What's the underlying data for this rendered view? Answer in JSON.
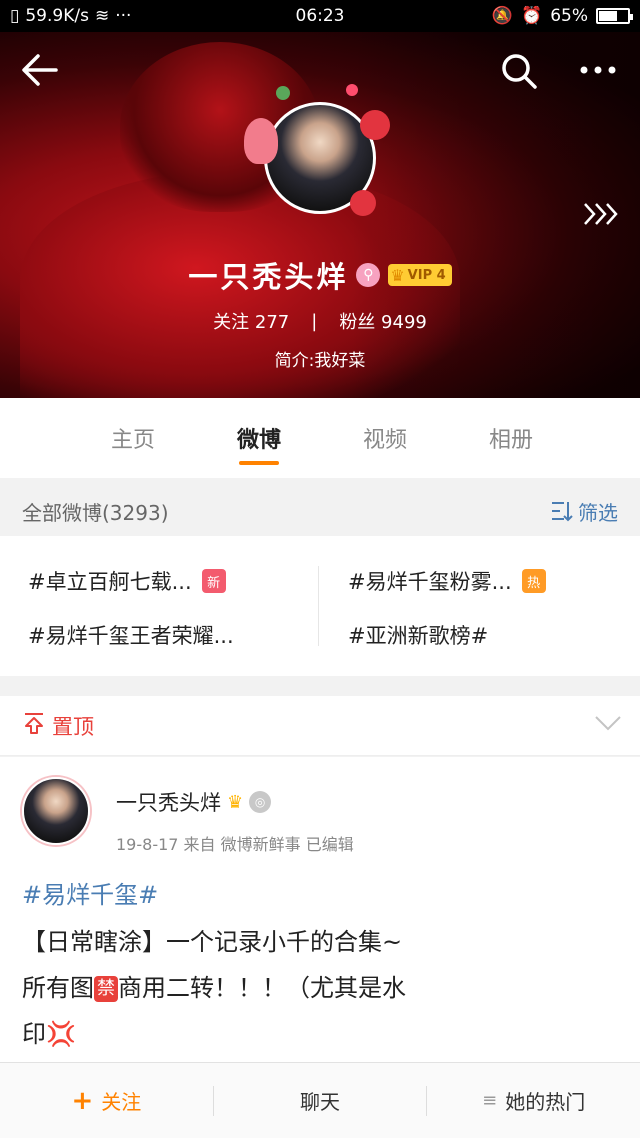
{
  "status_bar": {
    "net_speed": "59.9K/s",
    "time": "06:23",
    "battery_percent": "65%",
    "battery_level": 0.65
  },
  "header": {
    "nickname": "一只秃头烊",
    "vip_label": "VIP 4",
    "following_label": "关注",
    "following_count": "277",
    "separator": "|",
    "followers_label": "粉丝",
    "followers_count": "9499",
    "bio": "简介:我好菜"
  },
  "tabs": [
    {
      "label": "主页",
      "active": false
    },
    {
      "label": "微博",
      "active": true
    },
    {
      "label": "视频",
      "active": false
    },
    {
      "label": "相册",
      "active": false
    }
  ],
  "filter": {
    "title": "全部微博(3293)",
    "button_label": "筛选"
  },
  "topics": [
    {
      "text": "#卓立百舸七载...",
      "tag": "新"
    },
    {
      "text": "#易烊千玺粉雾...",
      "tag": "热"
    },
    {
      "text": "#易烊千玺王者荣耀...",
      "tag": ""
    },
    {
      "text": "#亚洲新歌榜#",
      "tag": ""
    }
  ],
  "pinned": {
    "label": "置顶"
  },
  "post": {
    "author": "一只秃头烊",
    "meta": "19-8-17  来自 微博新鲜事  已编辑",
    "hashtag": "#易烊千玺#",
    "line1": "【日常瞎涂】一个记录小千的合集~",
    "line2_a": "所有图",
    "ban_emoji": "禁",
    "line2_b": "商用二转！！！（尤其是水",
    "line3": "印",
    "anger_emoji": "💢"
  },
  "bottom_bar": {
    "follow_label": "关注",
    "chat_label": "聊天",
    "hot_label": "她的热门"
  },
  "colors": {
    "accent_orange": "#ff8200",
    "link_blue": "#4a7db3",
    "pin_red": "#e8413b",
    "vip_gold": "#ffcc33"
  },
  "icons": {
    "back": "arrow-left-icon",
    "search": "search-icon",
    "more": "more-dots-icon",
    "expand": "chevron-right-double-icon",
    "filter": "filter-icon",
    "pin": "pin-icon",
    "collapse": "chevron-down-icon"
  }
}
